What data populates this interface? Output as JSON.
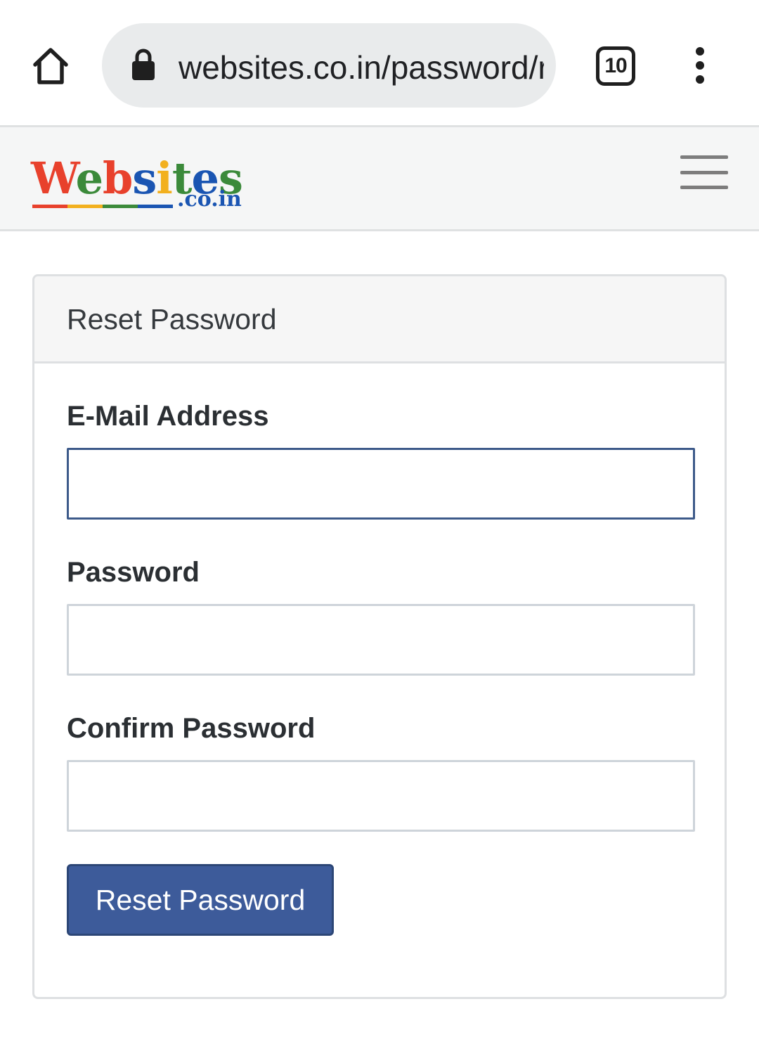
{
  "browser": {
    "url": "websites.co.in/password/reset",
    "tab_count": "10",
    "home_icon": "home-icon",
    "lock_icon": "lock-icon",
    "menu_icon": "vertical-dots-icon"
  },
  "site": {
    "logo_text": "Websites",
    "logo_subtext": ".co.in",
    "logo_letter_colors": [
      "#e8412c",
      "#3b8a3a",
      "#e8412c",
      "#1a55b2",
      "#f2b01e",
      "#3b8a3a",
      "#1a55b2",
      "#3b8a3a"
    ],
    "logo_underline_colors": [
      "#e8412c",
      "#f2b01e",
      "#3b8a3a",
      "#1a55b2"
    ],
    "menu_icon": "hamburger-menu-icon"
  },
  "form": {
    "title": "Reset Password",
    "email_label": "E-Mail Address",
    "email_value": "",
    "password_label": "Password",
    "password_value": "",
    "confirm_label": "Confirm Password",
    "confirm_value": "",
    "submit_label": "Reset Password"
  },
  "colors": {
    "primary_button": "#3d5b9a",
    "focused_border": "#3d5a8a",
    "input_border": "#ced4da"
  }
}
